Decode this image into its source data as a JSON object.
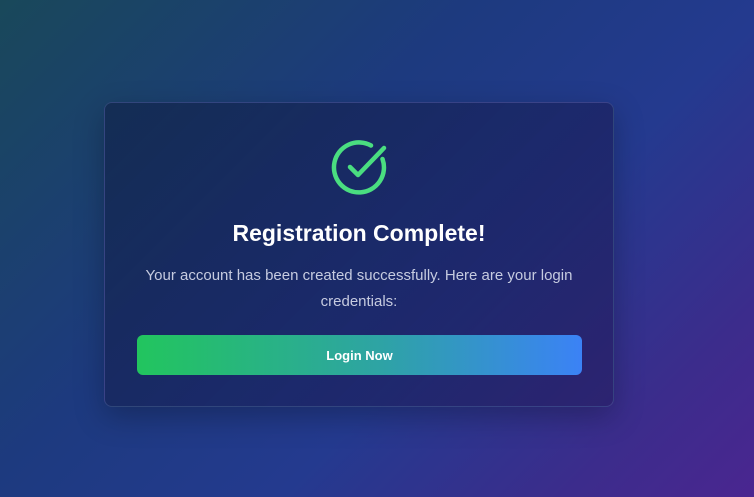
{
  "dialog": {
    "icon": "check-circle-icon",
    "title": "Registration Complete!",
    "message": "Your account has been created successfully. Here are your login credentials:",
    "login_button_label": "Login Now"
  },
  "colors": {
    "success": "#4ade80",
    "button_gradient_start": "#22c55e",
    "button_gradient_end": "#3b82f6"
  }
}
